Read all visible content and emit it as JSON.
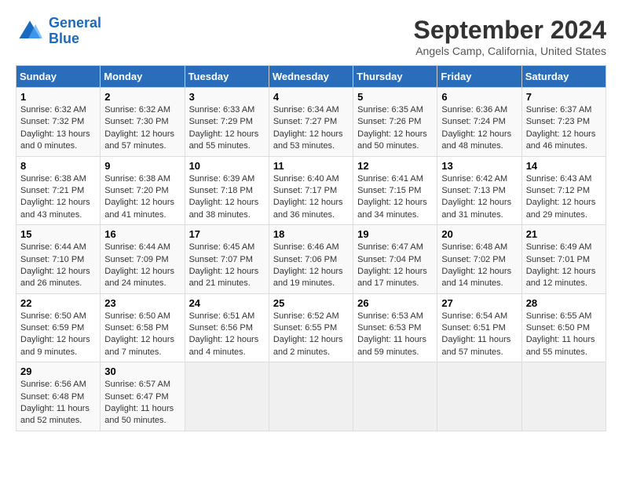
{
  "logo": {
    "line1": "General",
    "line2": "Blue"
  },
  "title": "September 2024",
  "subtitle": "Angels Camp, California, United States",
  "days_of_week": [
    "Sunday",
    "Monday",
    "Tuesday",
    "Wednesday",
    "Thursday",
    "Friday",
    "Saturday"
  ],
  "weeks": [
    [
      {
        "day": "1",
        "info": "Sunrise: 6:32 AM\nSunset: 7:32 PM\nDaylight: 13 hours\nand 0 minutes."
      },
      {
        "day": "2",
        "info": "Sunrise: 6:32 AM\nSunset: 7:30 PM\nDaylight: 12 hours\nand 57 minutes."
      },
      {
        "day": "3",
        "info": "Sunrise: 6:33 AM\nSunset: 7:29 PM\nDaylight: 12 hours\nand 55 minutes."
      },
      {
        "day": "4",
        "info": "Sunrise: 6:34 AM\nSunset: 7:27 PM\nDaylight: 12 hours\nand 53 minutes."
      },
      {
        "day": "5",
        "info": "Sunrise: 6:35 AM\nSunset: 7:26 PM\nDaylight: 12 hours\nand 50 minutes."
      },
      {
        "day": "6",
        "info": "Sunrise: 6:36 AM\nSunset: 7:24 PM\nDaylight: 12 hours\nand 48 minutes."
      },
      {
        "day": "7",
        "info": "Sunrise: 6:37 AM\nSunset: 7:23 PM\nDaylight: 12 hours\nand 46 minutes."
      }
    ],
    [
      {
        "day": "8",
        "info": "Sunrise: 6:38 AM\nSunset: 7:21 PM\nDaylight: 12 hours\nand 43 minutes."
      },
      {
        "day": "9",
        "info": "Sunrise: 6:38 AM\nSunset: 7:20 PM\nDaylight: 12 hours\nand 41 minutes."
      },
      {
        "day": "10",
        "info": "Sunrise: 6:39 AM\nSunset: 7:18 PM\nDaylight: 12 hours\nand 38 minutes."
      },
      {
        "day": "11",
        "info": "Sunrise: 6:40 AM\nSunset: 7:17 PM\nDaylight: 12 hours\nand 36 minutes."
      },
      {
        "day": "12",
        "info": "Sunrise: 6:41 AM\nSunset: 7:15 PM\nDaylight: 12 hours\nand 34 minutes."
      },
      {
        "day": "13",
        "info": "Sunrise: 6:42 AM\nSunset: 7:13 PM\nDaylight: 12 hours\nand 31 minutes."
      },
      {
        "day": "14",
        "info": "Sunrise: 6:43 AM\nSunset: 7:12 PM\nDaylight: 12 hours\nand 29 minutes."
      }
    ],
    [
      {
        "day": "15",
        "info": "Sunrise: 6:44 AM\nSunset: 7:10 PM\nDaylight: 12 hours\nand 26 minutes."
      },
      {
        "day": "16",
        "info": "Sunrise: 6:44 AM\nSunset: 7:09 PM\nDaylight: 12 hours\nand 24 minutes."
      },
      {
        "day": "17",
        "info": "Sunrise: 6:45 AM\nSunset: 7:07 PM\nDaylight: 12 hours\nand 21 minutes."
      },
      {
        "day": "18",
        "info": "Sunrise: 6:46 AM\nSunset: 7:06 PM\nDaylight: 12 hours\nand 19 minutes."
      },
      {
        "day": "19",
        "info": "Sunrise: 6:47 AM\nSunset: 7:04 PM\nDaylight: 12 hours\nand 17 minutes."
      },
      {
        "day": "20",
        "info": "Sunrise: 6:48 AM\nSunset: 7:02 PM\nDaylight: 12 hours\nand 14 minutes."
      },
      {
        "day": "21",
        "info": "Sunrise: 6:49 AM\nSunset: 7:01 PM\nDaylight: 12 hours\nand 12 minutes."
      }
    ],
    [
      {
        "day": "22",
        "info": "Sunrise: 6:50 AM\nSunset: 6:59 PM\nDaylight: 12 hours\nand 9 minutes."
      },
      {
        "day": "23",
        "info": "Sunrise: 6:50 AM\nSunset: 6:58 PM\nDaylight: 12 hours\nand 7 minutes."
      },
      {
        "day": "24",
        "info": "Sunrise: 6:51 AM\nSunset: 6:56 PM\nDaylight: 12 hours\nand 4 minutes."
      },
      {
        "day": "25",
        "info": "Sunrise: 6:52 AM\nSunset: 6:55 PM\nDaylight: 12 hours\nand 2 minutes."
      },
      {
        "day": "26",
        "info": "Sunrise: 6:53 AM\nSunset: 6:53 PM\nDaylight: 11 hours\nand 59 minutes."
      },
      {
        "day": "27",
        "info": "Sunrise: 6:54 AM\nSunset: 6:51 PM\nDaylight: 11 hours\nand 57 minutes."
      },
      {
        "day": "28",
        "info": "Sunrise: 6:55 AM\nSunset: 6:50 PM\nDaylight: 11 hours\nand 55 minutes."
      }
    ],
    [
      {
        "day": "29",
        "info": "Sunrise: 6:56 AM\nSunset: 6:48 PM\nDaylight: 11 hours\nand 52 minutes."
      },
      {
        "day": "30",
        "info": "Sunrise: 6:57 AM\nSunset: 6:47 PM\nDaylight: 11 hours\nand 50 minutes."
      },
      {
        "day": "",
        "info": ""
      },
      {
        "day": "",
        "info": ""
      },
      {
        "day": "",
        "info": ""
      },
      {
        "day": "",
        "info": ""
      },
      {
        "day": "",
        "info": ""
      }
    ]
  ]
}
